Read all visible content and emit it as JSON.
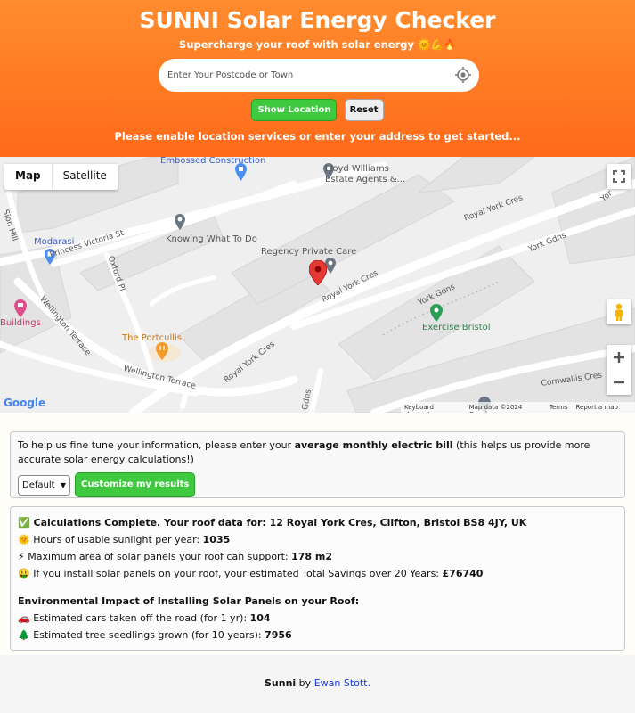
{
  "header": {
    "title": "SUNNI Solar Energy Checker",
    "subtitle": "Supercharge your roof with solar energy 🌞💪🔥",
    "search_placeholder": "Enter Your Postcode or Town",
    "show_location_label": "Show Location",
    "reset_label": "Reset",
    "message": "Please enable location services or enter your address to get started..."
  },
  "map": {
    "tabs": [
      "Map",
      "Satellite"
    ],
    "labels": {
      "embossed": "Embossed Construction",
      "lloyd1": "Lloyd Williams",
      "lloyd2": "Estate Agents &...",
      "modarasi": "Modarasi",
      "knowing": "Knowing What To Do",
      "regency": "Regency Private Care",
      "princess": "Princess Victoria St",
      "oxford": "Oxford Pl",
      "sion": "Sion Hill",
      "wellington1": "Wellington Terrace",
      "wellington2": "Wellington Terrace",
      "portcullis": "The Portcullis",
      "buildings": "Buildings",
      "royalyork1": "Royal York Cres",
      "royalyork2": "Royal York Cres",
      "royalyork3": "Royal York Cres",
      "yorkgdns1": "York Gdns",
      "yorkgdns2": "York Gdns",
      "exercise": "Exercise Bristol",
      "cornwallis": "Cornwallis Cres",
      "gdns": "Gdns",
      "yor": "Yor"
    },
    "footer": {
      "shortcuts": "Keyboard shortcuts",
      "data": "Map data ©2024 Google",
      "terms": "Terms",
      "report": "Report a map error"
    },
    "google": "Google"
  },
  "bill": {
    "text_before": "To help us fine tune your information, please enter your ",
    "text_bold": "average monthly electric bill",
    "text_after": " (this helps us provide more accurate solar energy calculations!)",
    "select_value": "Default",
    "customize_label": "Customize my results"
  },
  "results": {
    "complete": "✅ Calculations Complete. Your roof data for: 12 Royal York Cres, Clifton, Bristol BS8 4JY, UK",
    "sunlight_label": "🌞 Hours of usable sunlight per year: ",
    "sunlight_value": "1035",
    "area_label": "⚡ Maximum area of solar panels your roof can support: ",
    "area_value": "178 m2",
    "savings_label": "🤑 If you install solar panels on your roof, your estimated Total Savings over 20 Years: ",
    "savings_value": "£76740",
    "env_title": "Environmental Impact of Installing Solar Panels on your Roof:",
    "cars_label": "🚗 Estimated cars taken off the road (for 1 yr): ",
    "cars_value": "104",
    "trees_label": "🌲 Estimated tree seedlings grown (for 10 years): ",
    "trees_value": "7956"
  },
  "footer": {
    "brand": "Sunni",
    "by": " by ",
    "author": "Ewan Stott."
  }
}
